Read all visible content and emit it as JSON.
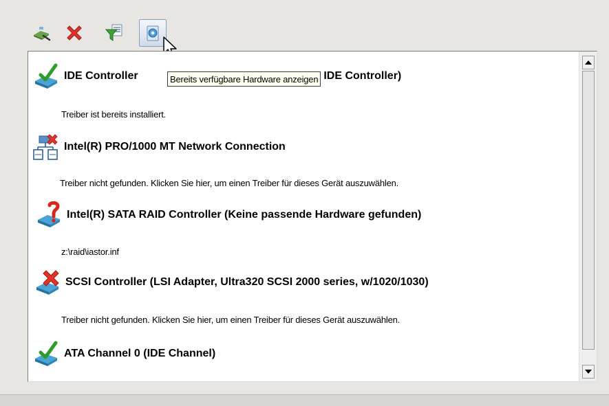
{
  "toolbar": {
    "buttons": [
      {
        "name": "add-driver-button",
        "icon": "add-driver-icon"
      },
      {
        "name": "remove-button",
        "icon": "red-x-icon"
      },
      {
        "name": "filter-button",
        "icon": "filter-icon"
      },
      {
        "name": "show-hardware-button",
        "icon": "hardware-settings-icon",
        "active": true
      }
    ]
  },
  "tooltip": {
    "text": "Bereits verfügbare Hardware anzeigen"
  },
  "devices": [
    {
      "title": "IDE Controller",
      "title_visible_tail": "ster IDE Controller)",
      "detail": "Treiber ist bereits installiert.",
      "status_icon": "check-icon"
    },
    {
      "title": "Intel(R) PRO/1000 MT Network Connection",
      "detail": "Treiber nicht gefunden. Klicken Sie hier, um einen Treiber für dieses Gerät auszuwählen.",
      "status_icon": "network-error-icon"
    },
    {
      "title": "Intel(R) SATA RAID Controller (Keine passende Hardware gefunden)",
      "detail": "z:\\raid\\iastor.inf",
      "status_icon": "question-icon"
    },
    {
      "title": "SCSI Controller (LSI Adapter, Ultra320 SCSI 2000 series, w/1020/1030)",
      "detail": "Treiber nicht gefunden. Klicken Sie hier, um einen Treiber für dieses Gerät auszuwählen.",
      "status_icon": "error-icon"
    },
    {
      "title": "ATA Channel 0 (IDE Channel)",
      "detail": "",
      "status_icon": "check-icon"
    }
  ],
  "colors": {
    "window_bg": "#e8e6e3",
    "tooltip_bg": "#fffff0",
    "check_green": "#3aa832",
    "error_red": "#d9261c",
    "device_blue": "#3f97c9"
  }
}
